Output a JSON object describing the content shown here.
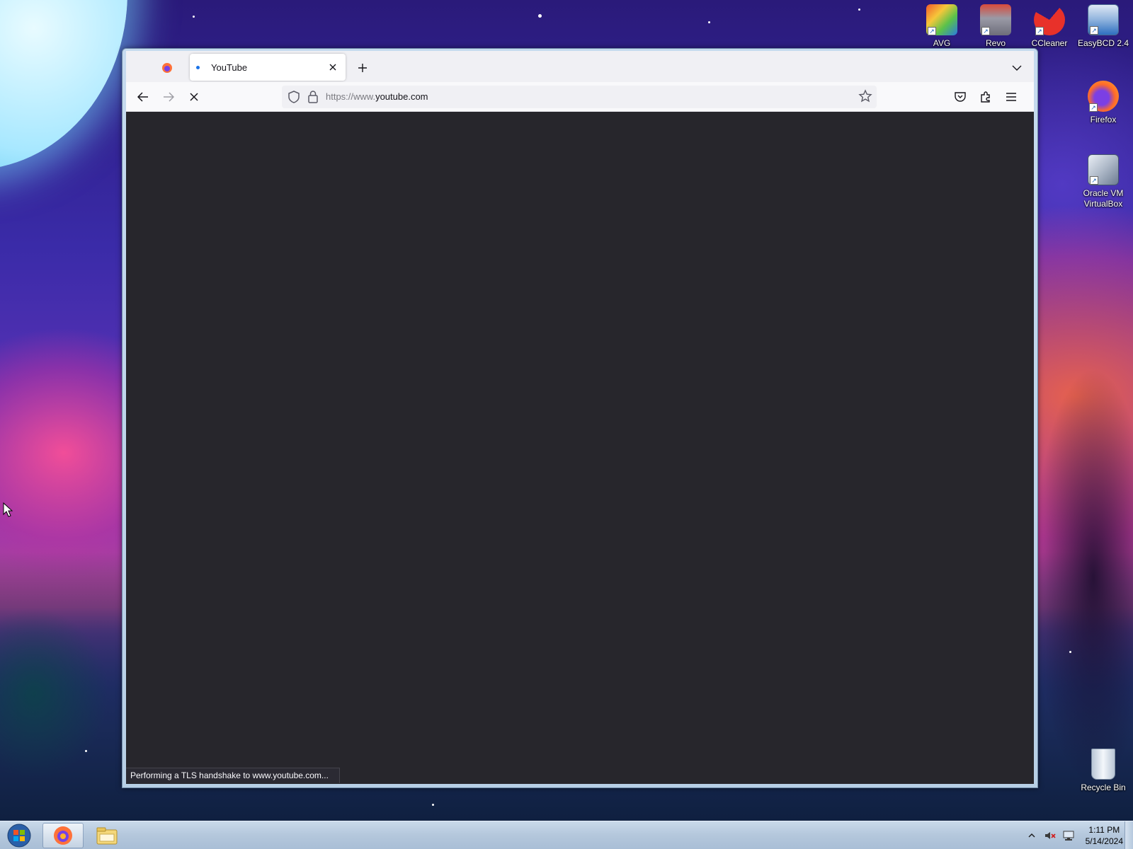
{
  "desktop": {
    "icons": [
      {
        "label": "AVG",
        "icon": "avg-icon"
      },
      {
        "label": "Revo",
        "icon": "revo-uninstaller-icon"
      },
      {
        "label": "CCleaner",
        "icon": "ccleaner-icon"
      },
      {
        "label": "EasyBCD 2.4",
        "icon": "easybcd-icon"
      },
      {
        "label": "Firefox",
        "icon": "firefox-icon"
      },
      {
        "label": "Oracle VM VirtualBox",
        "icon": "virtualbox-icon"
      },
      {
        "label": "Recycle Bin",
        "icon": "recycle-bin-icon"
      }
    ]
  },
  "browser": {
    "tabs": [
      {
        "title": "YouTube",
        "active": true
      }
    ],
    "url": {
      "prefix": "https://www.",
      "domain": "youtube.com"
    },
    "status_text": "Performing a TLS handshake to www.youtube.com...",
    "content_background": "#27262c"
  },
  "taskbar": {
    "items": [
      {
        "icon": "firefox-icon",
        "active": true
      },
      {
        "icon": "file-explorer-icon",
        "active": false
      }
    ],
    "clock": {
      "time": "1:11 PM",
      "date": "5/14/2024"
    }
  },
  "colors": {
    "accent": "#0060df",
    "tab_favicon": "#1a73e8",
    "close_button": "#c23a22"
  }
}
